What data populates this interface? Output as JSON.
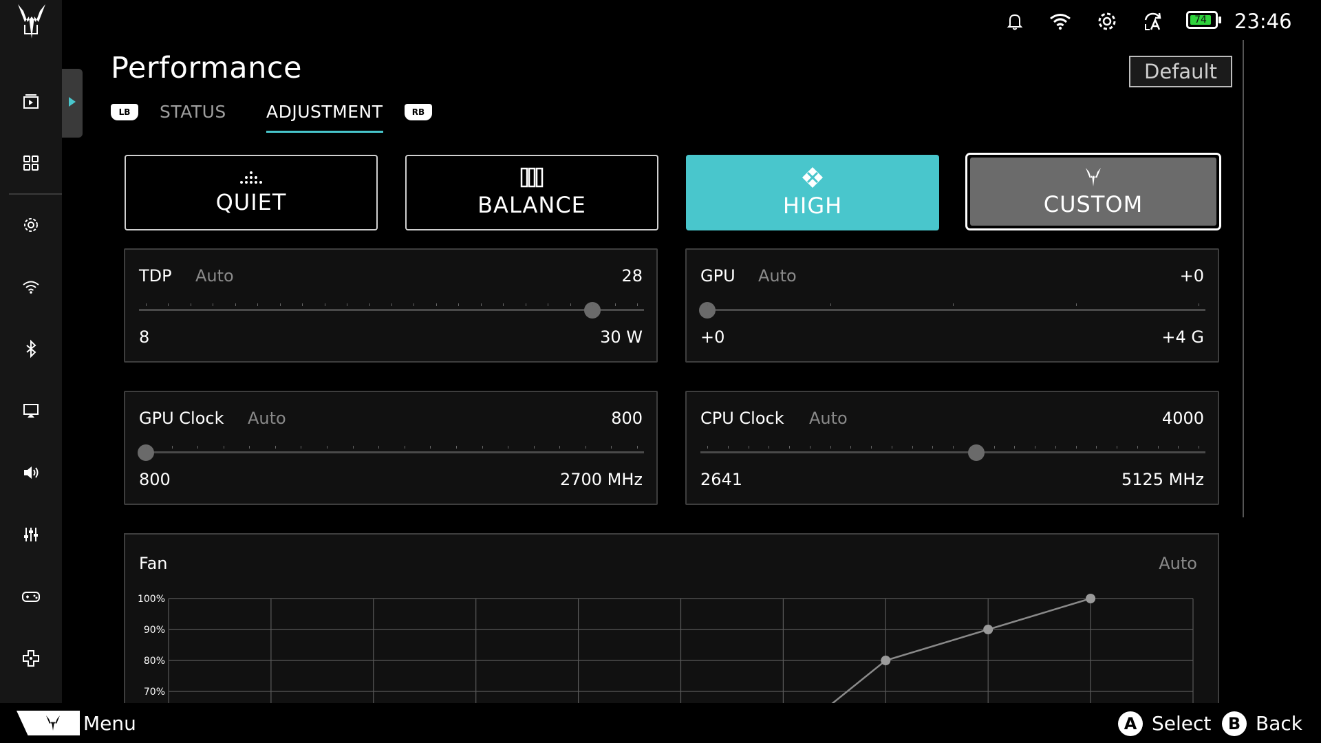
{
  "status_bar": {
    "icons": [
      "bell-icon",
      "wifi-icon",
      "gear-icon",
      "refresh-icon",
      "battery-icon"
    ],
    "battery_percent": "74",
    "time": "23:46"
  },
  "sidebar": {
    "items": [
      {
        "icon": "library-icon"
      },
      {
        "icon": "media-icon"
      },
      {
        "icon": "apps-grid-icon"
      },
      {
        "icon": "settings-icon"
      },
      {
        "icon": "wifi-icon"
      },
      {
        "icon": "bluetooth-icon"
      },
      {
        "icon": "display-cast-icon"
      },
      {
        "icon": "volume-icon"
      },
      {
        "icon": "equalizer-icon"
      },
      {
        "icon": "gamepad-icon"
      },
      {
        "icon": "dpad-icon"
      }
    ]
  },
  "header": {
    "title": "Performance",
    "default_label": "Default",
    "tabs": [
      {
        "label": "STATUS",
        "active": false
      },
      {
        "label": "ADJUSTMENT",
        "active": true
      }
    ],
    "lb": "LB",
    "rb": "RB"
  },
  "modes": [
    {
      "label": "QUIET",
      "icon": "quiet-icon"
    },
    {
      "label": "BALANCE",
      "icon": "balance-icon"
    },
    {
      "label": "HIGH",
      "icon": "high-icon",
      "selected": true
    },
    {
      "label": "CUSTOM",
      "icon": "custom-icon",
      "focused": true
    }
  ],
  "sliders": {
    "tdp": {
      "name": "TDP",
      "mode": "Auto",
      "value": "28",
      "min": "8",
      "max": "30 W",
      "fraction": 0.909
    },
    "gpu": {
      "name": "GPU",
      "mode": "Auto",
      "value": "+0",
      "min": "+0",
      "max": "+4 G",
      "fraction": 0.0
    },
    "gpu_clock": {
      "name": "GPU Clock",
      "mode": "Auto",
      "value": "800",
      "min": "800",
      "max": "2700 MHz",
      "fraction": 0.0
    },
    "cpu_clock": {
      "name": "CPU Clock",
      "mode": "Auto",
      "value": "4000",
      "min": "2641",
      "max": "5125 MHz",
      "fraction": 0.547
    }
  },
  "fan": {
    "title": "Fan",
    "mode": "Auto",
    "y_ticks": [
      "100%",
      "90%",
      "80%",
      "70%"
    ],
    "curve_points": [
      {
        "col": 6.25,
        "pct": 60
      },
      {
        "col": 7,
        "pct": 80
      },
      {
        "col": 8,
        "pct": 90
      },
      {
        "col": 9,
        "pct": 100
      }
    ],
    "columns": 10
  },
  "bottom_bar": {
    "menu_label": "Menu",
    "select_key": "A",
    "select_label": "Select",
    "back_key": "B",
    "back_label": "Back"
  },
  "colors": {
    "accent": "#49c6cc",
    "custom_bg": "#6b6b6b",
    "battery": "#2fd33c"
  }
}
